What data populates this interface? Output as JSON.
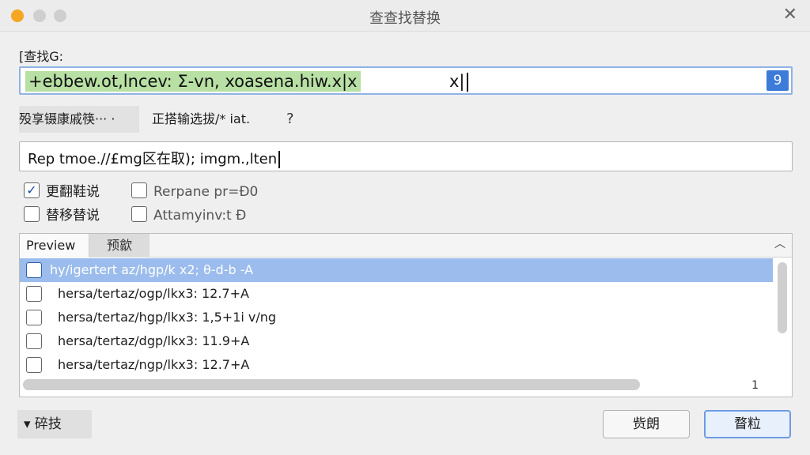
{
  "window": {
    "title": "查查找替换"
  },
  "find": {
    "label": "[查找G:",
    "highlight_text": "+ebbew.ot,lncev: Σ-vn, xoasena.hiw.x|x",
    "rest_text": "x|",
    "button_glyph": "9"
  },
  "options": {
    "dropdown_label": "殁享镊康戚筷··· ·",
    "text": "正搭输选拔/* iat.",
    "help_glyph": "?"
  },
  "replace": {
    "value": "Rep tmoe.//£mg区在取); imgm.,lten"
  },
  "checkboxes": [
    {
      "label": "更翻鞋说",
      "checked": true
    },
    {
      "label": "Rerpane pr=Ð0",
      "checked": false
    },
    {
      "label": "替移替说",
      "checked": false
    },
    {
      "label": "Attamyinv:t Ð",
      "checked": false
    }
  ],
  "preview": {
    "tabs": [
      "Preview",
      "预歙"
    ],
    "rows": [
      {
        "text": "hy/igertert az/hgp/k x2; θ-d-b -A",
        "selected": true,
        "checked": false
      },
      {
        "text": "hersa/tertaz/ogp/lkx3: 12.7+A",
        "selected": false,
        "checked": false
      },
      {
        "text": "hersa/tertaz/hgp/lkx3: 1,5+1i v/ng",
        "selected": false,
        "checked": false
      },
      {
        "text": "hersa/tertaz/dgp/lkx3: 11.9+A",
        "selected": false,
        "checked": false
      },
      {
        "text": "hersa/tertaz/ngp/lkx3: 12.7+A",
        "selected": false,
        "checked": false
      }
    ],
    "hscroll_end": "1"
  },
  "footer": {
    "details_label": "▾ 碎技",
    "secondary_label": "赀朗",
    "primary_label": "瞀粒"
  },
  "colors": {
    "accent": "#3d7bd9",
    "match_highlight": "#b8e0a4",
    "selected_row": "#9bbcec",
    "close_light": "#f5a623"
  }
}
